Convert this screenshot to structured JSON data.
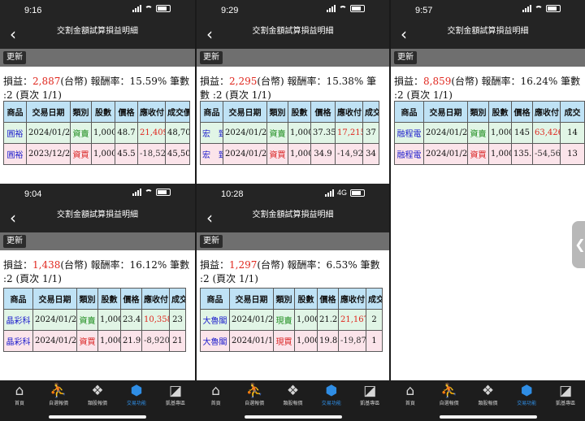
{
  "screens": [
    {
      "time": "9:16",
      "network": "",
      "title": "交割金額試算損益明細",
      "refresh": "更新",
      "summary": {
        "prefix": "損益：",
        "pl": "2,887",
        "suffix": "(台幣) 報酬率：15.59% 筆數 :2 (頁次 1/1)"
      },
      "headers": [
        "商品",
        "交易日期",
        "類別",
        "股數",
        "價格",
        "應收付",
        "成交價"
      ],
      "rows": [
        [
          "圓裕",
          "2024/01/26",
          "資賣",
          "1,000",
          "48.7",
          "21,409",
          "48,70"
        ],
        [
          "圓裕",
          "2023/12/28",
          "資買",
          "1,000",
          "45.5",
          "-18,522",
          "45,50"
        ]
      ]
    },
    {
      "time": "9:29",
      "network": "",
      "title": "交割金額試算損益明細",
      "refresh": "更新",
      "summary": {
        "prefix": "損益：",
        "pl": "2,295",
        "suffix": "(台幣) 報酬率：15.38% 筆數 :2 (頁次 1/1)"
      },
      "headers": [
        "商品",
        "交易日期",
        "類別",
        "股數",
        "價格",
        "應收付",
        "成交"
      ],
      "rows": [
        [
          "宏　致",
          "2024/01/26",
          "資賣",
          "1,000",
          "37.35",
          "17,215",
          "37"
        ],
        [
          "宏　致",
          "2024/01/25",
          "資買",
          "1,000",
          "34.9",
          "-14,920",
          "34"
        ]
      ]
    },
    {
      "time": "9:57",
      "network": "",
      "title": "交割金額試算損益明細",
      "refresh": "更新",
      "summary": {
        "prefix": "損益：",
        "pl": "8,859",
        "suffix": "(台幣) 報酬率：16.24% 筆數 :2 (頁次 1/1)"
      },
      "headers": [
        "商品",
        "交易日期",
        "類別",
        "股數",
        "價格",
        "應收付",
        "成交"
      ],
      "rows": [
        [
          "融程電",
          "2024/01/26",
          "資賣",
          "1,000",
          "145",
          "63,426",
          "14"
        ],
        [
          "融程電",
          "2024/01/23",
          "資買",
          "1,000",
          "135.5",
          "-54,567",
          "13"
        ]
      ]
    },
    {
      "time": "9:04",
      "network": "",
      "title": "交割金額試算損益明細",
      "refresh": "更新",
      "summary": {
        "prefix": "損益：",
        "pl": "1,438",
        "suffix": "(台幣) 報酬率：16.12% 筆數 :2 (頁次 1/1)"
      },
      "headers": [
        "商品",
        "交易日期",
        "類別",
        "股數",
        "價格",
        "應收付",
        "成交"
      ],
      "rows": [
        [
          "晶彩科",
          "2024/01/26",
          "資賣",
          "1,000",
          "23.45",
          "10,358",
          "23"
        ],
        [
          "晶彩科",
          "2024/01/25",
          "資買",
          "1,000",
          "21.9",
          "-8,920",
          "21"
        ]
      ]
    },
    {
      "time": "10:28",
      "network": "4G",
      "title": "交割金額試算損益明細",
      "refresh": "更新",
      "summary": {
        "prefix": "損益：",
        "pl": "1,297",
        "suffix": "(台幣) 報酬率：6.53% 筆數 :2 (頁次 1/1)"
      },
      "headers": [
        "商品",
        "交易日期",
        "類別",
        "股數",
        "價格",
        "應收付",
        "成交"
      ],
      "rows": [
        [
          "大魯閣",
          "2024/01/26",
          "現賣",
          "1,000",
          "21.25",
          "21,167",
          "2"
        ],
        [
          "大魯閣",
          "2024/01/12",
          "現買",
          "1,000",
          "19.85",
          "-19,870",
          "1"
        ]
      ]
    }
  ],
  "tabbar": {
    "items": [
      {
        "label": "首頁",
        "icon": "house-icon"
      },
      {
        "label": "自選報價",
        "icon": "person-chart-icon"
      },
      {
        "label": "類股報價",
        "icon": "tiles-icon"
      },
      {
        "label": "交易功能",
        "icon": "trade-icon",
        "active": true
      },
      {
        "label": "凱基專區",
        "icon": "kgi-icon"
      }
    ]
  },
  "colors": {
    "profit": "#e0281f",
    "buy_row": "#e1f5e6",
    "sell_row": "#fbe4ea",
    "header": "#bfe2f5",
    "active_tab": "#2f8de4"
  }
}
